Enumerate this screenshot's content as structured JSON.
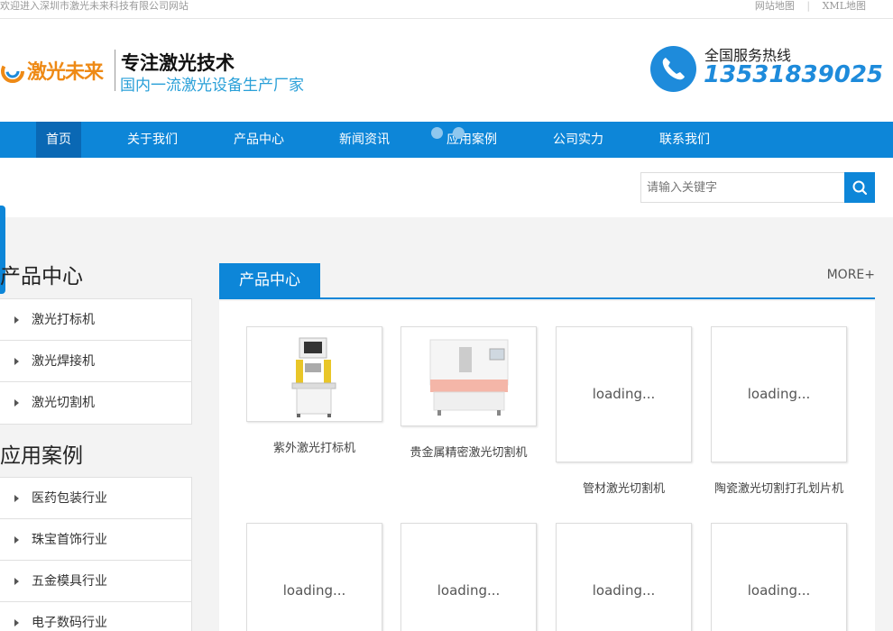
{
  "topbar": {
    "welcome": "欢迎进入深圳市激光未来科技有限公司网站",
    "links": [
      "网站地图",
      "XML地图"
    ]
  },
  "header": {
    "logo_text": "激光未来",
    "slogan_main": "专注激光技术",
    "slogan_sub": "国内一流激光设备生产厂家",
    "hotline_label": "全国服务热线",
    "hotline_number": "13531839025"
  },
  "nav": {
    "items": [
      "首页",
      "关于我们",
      "产品中心",
      "新闻资讯",
      "应用案例",
      "公司实力",
      "联系我们"
    ],
    "active_index": 0
  },
  "search": {
    "placeholder": "请输入关键字"
  },
  "sidebar": {
    "products_title": "产品中心",
    "products": [
      "激光打标机",
      "激光焊接机",
      "激光切割机"
    ],
    "cases_title": "应用案例",
    "cases": [
      "医药包装行业",
      "珠宝首饰行业",
      "五金模具行业",
      "电子数码行业"
    ]
  },
  "main": {
    "tab_label": "产品中心",
    "more_label": "MORE+",
    "loading_text": "loading...",
    "products": [
      {
        "name": "紫外激光打标机",
        "status": "image"
      },
      {
        "name": "贵金属精密激光切割机",
        "status": "image"
      },
      {
        "name": "管材激光切割机",
        "status": "loading"
      },
      {
        "name": "陶瓷激光切割打孔划片机",
        "status": "loading"
      },
      {
        "name": "",
        "status": "loading"
      },
      {
        "name": "",
        "status": "loading"
      },
      {
        "name": "",
        "status": "loading"
      },
      {
        "name": "",
        "status": "loading"
      }
    ]
  },
  "colors": {
    "primary": "#0d86d8",
    "nav_active": "#0a68b4",
    "logo_orange": "#ee8a16",
    "slogan_blue": "#2aa0d8"
  }
}
